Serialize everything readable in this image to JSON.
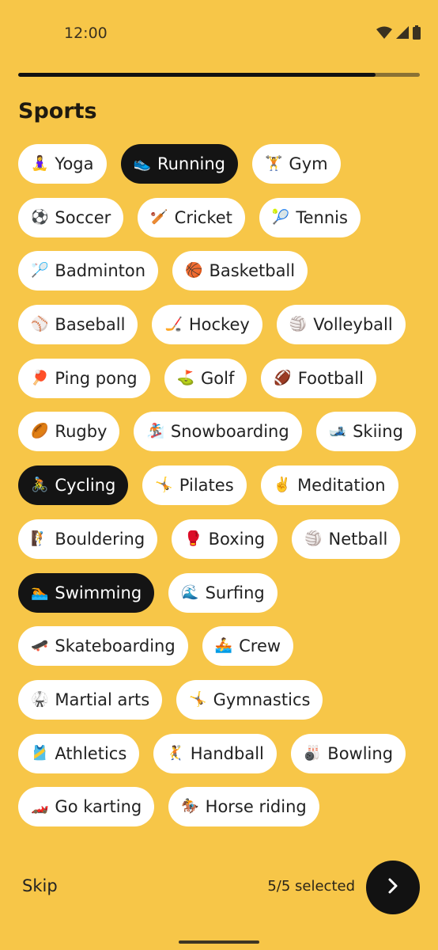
{
  "status": {
    "time": "12:00"
  },
  "progress": {
    "fraction": 0.89
  },
  "page": {
    "title": "Sports"
  },
  "rows": [
    [
      {
        "label": "Yoga",
        "icon": "🧘‍♀️",
        "selected": false
      },
      {
        "label": "Running",
        "icon": "👟",
        "selected": true
      },
      {
        "label": "Gym",
        "icon": "🏋️",
        "selected": false
      }
    ],
    [
      {
        "label": "Soccer",
        "icon": "⚽",
        "selected": false
      },
      {
        "label": "Cricket",
        "icon": "🏏",
        "selected": false
      },
      {
        "label": "Tennis",
        "icon": "🎾",
        "selected": false
      }
    ],
    [
      {
        "label": "Badminton",
        "icon": "🏸",
        "selected": false
      },
      {
        "label": "Basketball",
        "icon": "🏀",
        "selected": false
      }
    ],
    [
      {
        "label": "Baseball",
        "icon": "⚾",
        "selected": false
      },
      {
        "label": "Hockey",
        "icon": "🏒",
        "selected": false
      },
      {
        "label": "Volleyball",
        "icon": "🏐",
        "selected": false
      }
    ],
    [
      {
        "label": "Ping pong",
        "icon": "🏓",
        "selected": false
      },
      {
        "label": "Golf",
        "icon": "⛳",
        "selected": false
      },
      {
        "label": "Football",
        "icon": "🏈",
        "selected": false
      }
    ],
    [
      {
        "label": "Rugby",
        "icon": "🏉",
        "selected": false
      },
      {
        "label": "Snowboarding",
        "icon": "🏂",
        "selected": false
      },
      {
        "label": "Skiing",
        "icon": "🎿",
        "selected": false
      }
    ],
    [
      {
        "label": "Cycling",
        "icon": "🚴",
        "selected": true
      },
      {
        "label": "Pilates",
        "icon": "🤸",
        "selected": false
      },
      {
        "label": "Meditation",
        "icon": "✌️",
        "selected": false
      }
    ],
    [
      {
        "label": "Bouldering",
        "icon": "🧗",
        "selected": false
      },
      {
        "label": "Boxing",
        "icon": "🥊",
        "selected": false
      },
      {
        "label": "Netball",
        "icon": "🏐",
        "selected": false
      }
    ],
    [
      {
        "label": "Swimming",
        "icon": "🏊",
        "selected": true
      },
      {
        "label": "Surfing",
        "icon": "🌊",
        "selected": false
      }
    ],
    [
      {
        "label": "Skateboarding",
        "icon": "🛹",
        "selected": false
      },
      {
        "label": "Crew",
        "icon": "🚣",
        "selected": false
      }
    ],
    [
      {
        "label": "Martial arts",
        "icon": "🥋",
        "selected": false
      },
      {
        "label": "Gymnastics",
        "icon": "🤸",
        "selected": false
      }
    ],
    [
      {
        "label": "Athletics",
        "icon": "🎽",
        "selected": false
      },
      {
        "label": "Handball",
        "icon": "🤾",
        "selected": false
      },
      {
        "label": "Bowling",
        "icon": "🎳",
        "selected": false
      }
    ],
    [
      {
        "label": "Go karting",
        "icon": "🏎️",
        "selected": false
      },
      {
        "label": "Horse riding",
        "icon": "🏇",
        "selected": false
      }
    ]
  ],
  "footer": {
    "skip_label": "Skip",
    "selected_count": "5/5 selected"
  }
}
